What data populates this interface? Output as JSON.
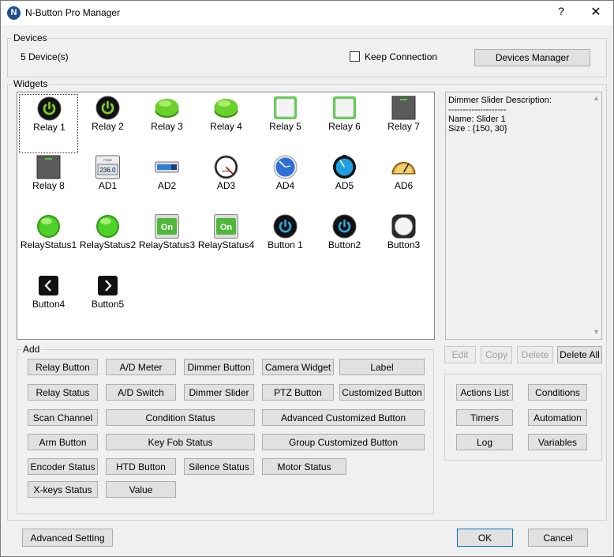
{
  "window": {
    "title": "N-Button Pro Manager",
    "help": "?",
    "close": "✕",
    "app_icon": "N"
  },
  "devices": {
    "group_label": "Devices",
    "count": "5 Device(s)",
    "keep_connection": "Keep Connection",
    "manager_button": "Devices Manager"
  },
  "widgets": {
    "group_label": "Widgets",
    "items": [
      {
        "label": "Relay 1",
        "icon": "power-green-icon"
      },
      {
        "label": "Relay 2",
        "icon": "power-green-icon"
      },
      {
        "label": "Relay 3",
        "icon": "green-button-icon"
      },
      {
        "label": "Relay 4",
        "icon": "green-button-icon"
      },
      {
        "label": "Relay 5",
        "icon": "green-square-icon"
      },
      {
        "label": "Relay 6",
        "icon": "green-square-icon"
      },
      {
        "label": "Relay 7",
        "icon": "gray-square-icon"
      },
      {
        "label": "Relay 8",
        "icon": "gray-square-icon"
      },
      {
        "label": "AD1",
        "icon": "lcd-display-icon"
      },
      {
        "label": "AD2",
        "icon": "bar-meter-icon"
      },
      {
        "label": "AD3",
        "icon": "gauge-dark-icon"
      },
      {
        "label": "AD4",
        "icon": "gauge-blue-icon"
      },
      {
        "label": "AD5",
        "icon": "gauge-blue-dark-icon"
      },
      {
        "label": "AD6",
        "icon": "gauge-gold-icon"
      },
      {
        "label": "RelayStatus1",
        "icon": "green-led-icon"
      },
      {
        "label": "RelayStatus2",
        "icon": "green-led-icon"
      },
      {
        "label": "RelayStatus3",
        "icon": "on-switch-icon"
      },
      {
        "label": "RelayStatus4",
        "icon": "on-switch-icon"
      },
      {
        "label": "Button 1",
        "icon": "power-blue-icon"
      },
      {
        "label": "Button2",
        "icon": "power-blue-icon"
      },
      {
        "label": "Button3",
        "icon": "white-round-button-icon"
      },
      {
        "label": "Button4",
        "icon": "chevron-left-icon"
      },
      {
        "label": "Button5",
        "icon": "chevron-right-icon"
      }
    ],
    "on_text": "On",
    "lcd_text": "236.0",
    "lcd_small": "PSSE",
    "gauge_text": "ASKL"
  },
  "description": {
    "text": "Dimmer Slider Description:\n--------------------\nName: Slider 1\nSize : {150, 30}"
  },
  "edit_buttons": {
    "edit": "Edit",
    "copy": "Copy",
    "delete": "Delete",
    "delete_all": "Delete All"
  },
  "add": {
    "group_label": "Add",
    "buttons": {
      "relay_button": "Relay Button",
      "ad_meter": "A/D Meter",
      "dimmer_button": "Dimmer Button",
      "camera_widget": "Camera Widget",
      "label": "Label",
      "relay_status": "Relay Status",
      "ad_switch": "A/D Switch",
      "dimmer_slider": "Dimmer Slider",
      "ptz_button": "PTZ Button",
      "customized_button": "Customized Button",
      "scan_channel": "Scan Channel",
      "condition_status": "Condition Status",
      "advanced_customized_button": "Advanced Customized Button",
      "arm_button": "Arm Button",
      "key_fob_status": "Key Fob Status",
      "group_customized_button": "Group Customized Button",
      "encoder_status": "Encoder Status",
      "htd_button": "HTD Button",
      "silence_status": "Silence Status",
      "motor_status": "Motor Status",
      "xkeys_status": "X-keys Status",
      "value": "Value"
    }
  },
  "side_buttons": {
    "actions_list": "Actions List",
    "conditions": "Conditions",
    "timers": "Timers",
    "automation": "Automation",
    "log": "Log",
    "variables": "Variables"
  },
  "footer": {
    "advanced_setting": "Advanced Setting",
    "ok": "OK",
    "cancel": "Cancel"
  }
}
